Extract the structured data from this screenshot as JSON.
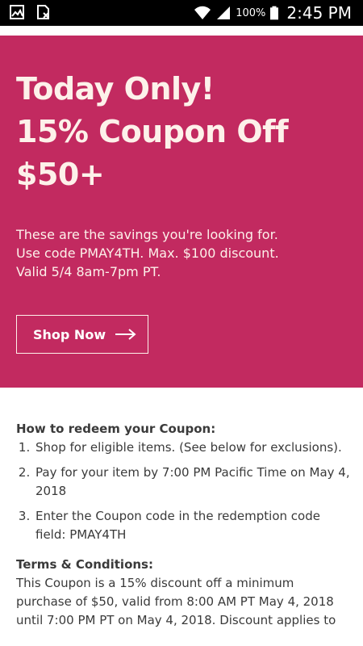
{
  "status_bar": {
    "battery_percent": "100%",
    "time": "2:45 PM",
    "icons": [
      "gallery-icon",
      "sim-icon",
      "wifi-icon",
      "signal-icon",
      "battery-icon"
    ]
  },
  "hero": {
    "background_color": "#c22a60",
    "title_lines": [
      "Today Only!",
      "15% Coupon Off",
      "$50+"
    ],
    "subtitle_lines": [
      "These are the savings you're looking for.",
      "Use code PMAY4TH. Max. $100 discount.",
      "Valid 5/4 8am-7pm PT."
    ],
    "button_label": "Shop Now",
    "button_icon": "arrow-right-icon"
  },
  "redeem": {
    "heading": "How to redeem your Coupon:",
    "steps": [
      "Shop for eligible items. (See below for exclusions).",
      "Pay for your item by 7:00 PM Pacific Time on May 4, 2018",
      "Enter the Coupon code in the redemption code field: PMAY4TH"
    ]
  },
  "terms": {
    "heading": "Terms & Conditions:",
    "body": "This Coupon is a 15% discount off a minimum purchase of $50, valid from 8:00 AM PT May 4, 2018 until 7:00 PM PT on May 4, 2018. Discount applies to"
  }
}
